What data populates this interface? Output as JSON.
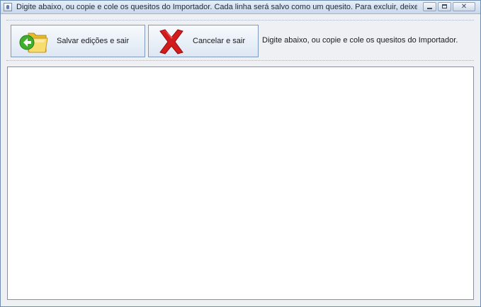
{
  "window": {
    "title": "Digite abaixo, ou copie e cole os  quesitos do Importador. Cada linha será salvo como um quesito. Para excluir, deixe as linhas em b...",
    "close_glyph": "✕"
  },
  "toolbar": {
    "save_label": "Salvar edições e sair",
    "cancel_label": "Cancelar e sair",
    "instructions": "Digite abaixo, ou copie e cole os quesitos do Importador."
  },
  "icons": {
    "save": "folder-arrow-icon",
    "cancel": "red-x-icon"
  },
  "editor": {
    "value": ""
  },
  "colors": {
    "folder": "#f4d35a",
    "arrow": "#3fae2c",
    "cancel_x": "#d41b1b",
    "button_border": "#7e9abd"
  }
}
